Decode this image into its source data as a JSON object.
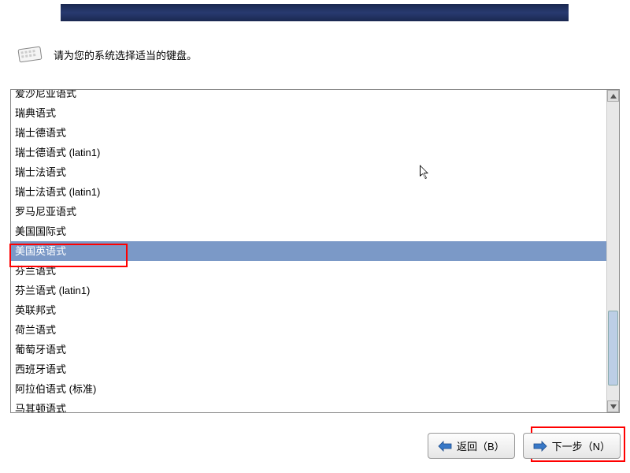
{
  "instruction": "请为您的系统选择适当的键盘。",
  "keyboards": [
    "爱沙尼业语式",
    "瑞典语式",
    "瑞士德语式",
    "瑞士德语式 (latin1)",
    "瑞士法语式",
    "瑞士法语式 (latin1)",
    "罗马尼亚语式",
    "美国国际式",
    "美国英语式",
    "芬兰语式",
    "芬兰语式 (latin1)",
    "英联邦式",
    "荷兰语式",
    "葡萄牙语式",
    "西班牙语式",
    "阿拉伯语式 (标准)",
    "马其顿语式"
  ],
  "selected_index": 8,
  "buttons": {
    "back": "返回（B）",
    "next": "下一步（N）"
  }
}
